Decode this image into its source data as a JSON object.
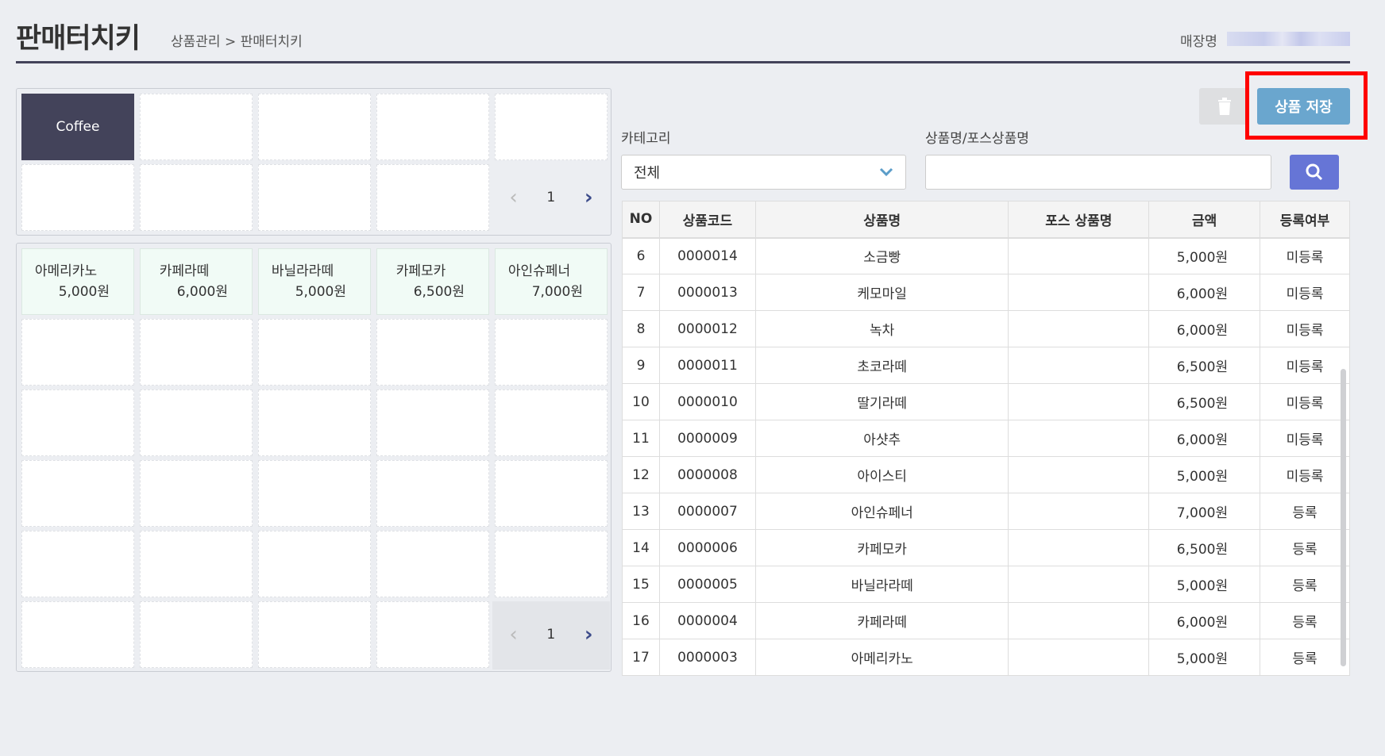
{
  "header": {
    "title": "판매터치키",
    "breadcrumb": "상품관리 > 판매터치키",
    "store_label": "매장명"
  },
  "categories": {
    "items": [
      "Coffee"
    ],
    "page": "1"
  },
  "products": {
    "items": [
      {
        "name": "아메리카노",
        "price": "5,000원"
      },
      {
        "name": "카페라떼",
        "price": "6,000원"
      },
      {
        "name": "바닐라라떼",
        "price": "5,000원"
      },
      {
        "name": "카페모카",
        "price": "6,500원"
      },
      {
        "name": "아인슈페너",
        "price": "7,000원"
      }
    ],
    "page": "1"
  },
  "toolbar": {
    "delete_icon": "trash-icon",
    "save_label": "상품 저장"
  },
  "filters": {
    "category_label": "카테고리",
    "category_value": "전체",
    "search_label": "상품명/포스상품명",
    "search_value": ""
  },
  "table": {
    "headers": [
      "NO",
      "상품코드",
      "상품명",
      "포스 상품명",
      "금액",
      "등록여부"
    ],
    "rows": [
      [
        "6",
        "0000014",
        "소금빵",
        "",
        "5,000원",
        "미등록"
      ],
      [
        "7",
        "0000013",
        "케모마일",
        "",
        "6,000원",
        "미등록"
      ],
      [
        "8",
        "0000012",
        "녹차",
        "",
        "6,000원",
        "미등록"
      ],
      [
        "9",
        "0000011",
        "초코라떼",
        "",
        "6,500원",
        "미등록"
      ],
      [
        "10",
        "0000010",
        "딸기라떼",
        "",
        "6,500원",
        "미등록"
      ],
      [
        "11",
        "0000009",
        "아샷추",
        "",
        "6,000원",
        "미등록"
      ],
      [
        "12",
        "0000008",
        "아이스티",
        "",
        "5,000원",
        "미등록"
      ],
      [
        "13",
        "0000007",
        "아인슈페너",
        "",
        "7,000원",
        "등록"
      ],
      [
        "14",
        "0000006",
        "카페모카",
        "",
        "6,500원",
        "등록"
      ],
      [
        "15",
        "0000005",
        "바닐라라떼",
        "",
        "5,000원",
        "등록"
      ],
      [
        "16",
        "0000004",
        "카페라떼",
        "",
        "6,000원",
        "등록"
      ],
      [
        "17",
        "0000003",
        "아메리카노",
        "",
        "5,000원",
        "등록"
      ]
    ]
  }
}
